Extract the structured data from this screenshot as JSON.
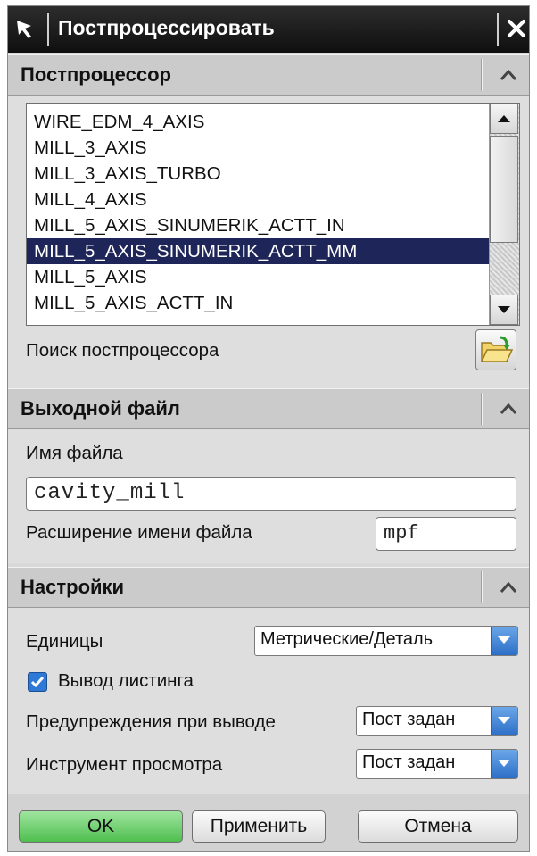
{
  "window": {
    "title": "Постпроцессировать"
  },
  "postprocessor": {
    "header": "Постпроцессор",
    "items": [
      "WIRE_EDM_4_AXIS",
      "MILL_3_AXIS",
      "MILL_3_AXIS_TURBO",
      "MILL_4_AXIS",
      "MILL_5_AXIS_SINUMERIK_ACTT_IN",
      "MILL_5_AXIS_SINUMERIK_ACTT_MM",
      "MILL_5_AXIS",
      "MILL_5_AXIS_ACTT_IN"
    ],
    "selected_index": 5,
    "browse_label": "Поиск постпроцессора"
  },
  "output_file": {
    "header": "Выходной файл",
    "filename_label": "Имя файла",
    "filename_value": "cavity_mill",
    "extension_label": "Расширение имени файла",
    "extension_value": "mpf"
  },
  "settings": {
    "header": "Настройки",
    "units_label": "Единицы",
    "units_value": "Метрические/Деталь",
    "listing_label": "Вывод листинга",
    "listing_checked": true,
    "warnings_label": "Предупреждения при выводе",
    "warnings_value": "Пост задан",
    "viewer_label": "Инструмент просмотра",
    "viewer_value": "Пост задан"
  },
  "buttons": {
    "ok": "OK",
    "apply": "Применить",
    "cancel": "Отмена"
  },
  "colors": {
    "selection": "#1e2558",
    "ok_button": "#5cc65c",
    "combo_arrow": "#3a7fd6",
    "checkbox": "#2e79d6"
  }
}
